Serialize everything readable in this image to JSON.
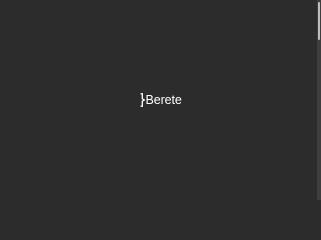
{
  "brand": {
    "name": "Berete",
    "logo_icon": "bracket-mark-icon",
    "text_color": "#ffffff"
  },
  "page": {
    "background_color": "#2c2c2c"
  },
  "scrollbar": {
    "track_color": "#3e3e3e",
    "thumb_color": "#bdbdbd"
  }
}
